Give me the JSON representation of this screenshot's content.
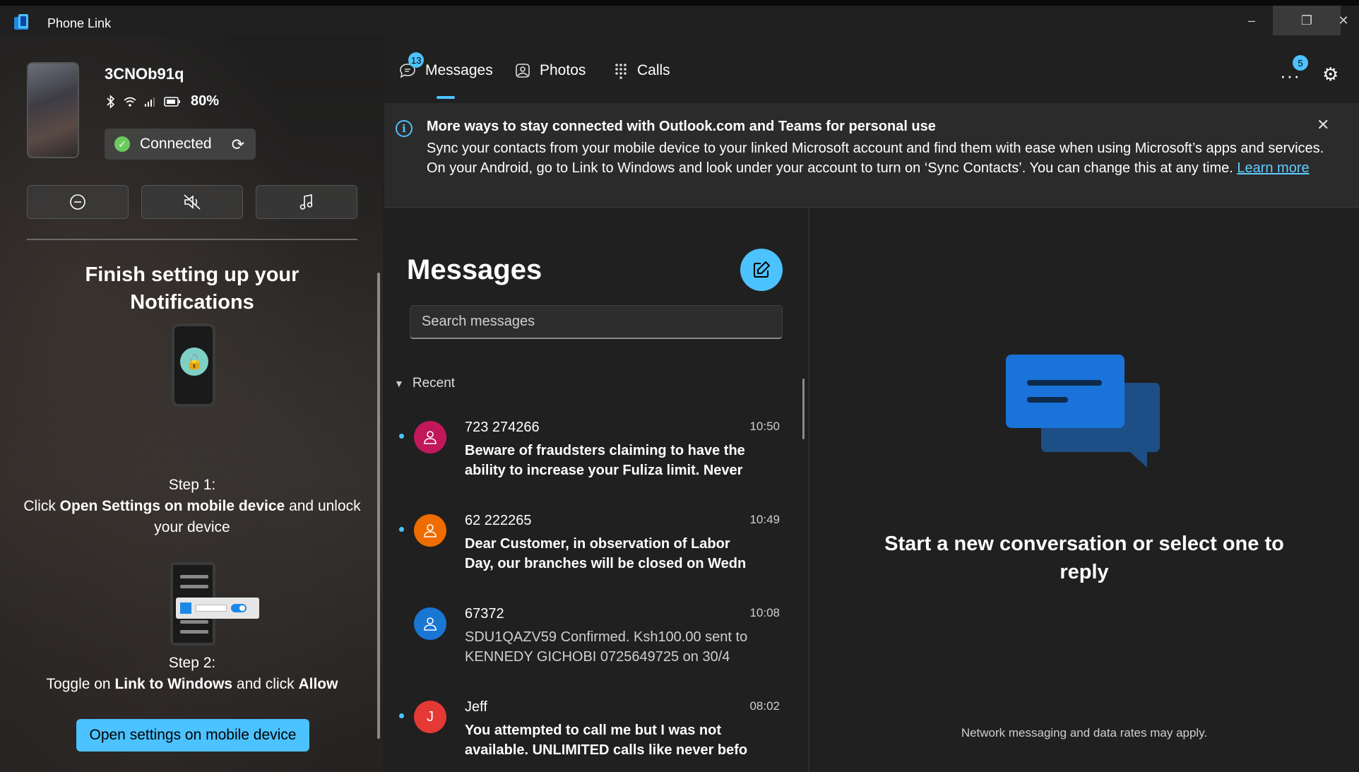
{
  "window": {
    "title": "Phone Link",
    "controls": {
      "minimize": "–",
      "restore": "❐",
      "close": "✕"
    }
  },
  "device": {
    "name": "3CNOb91q",
    "battery": "80%",
    "status": "Connected",
    "quick_actions": [
      "do-not-disturb",
      "mute-audio",
      "media-player"
    ]
  },
  "setup": {
    "title": "Finish setting up your Notifications",
    "step1_label": "Step 1:",
    "step1_text_a": "Click ",
    "step1_bold": "Open Settings on mobile device",
    "step1_text_b": " and unlock your device",
    "step2_label": "Step 2:",
    "step2_text_a": "Toggle on ",
    "step2_bold_a": "Link to Windows",
    "step2_text_b": " and click ",
    "step2_bold_b": "Allow",
    "button": "Open settings on mobile device"
  },
  "nav": {
    "tabs": [
      {
        "label": "Messages",
        "icon": "chat-icon",
        "badge": "13",
        "active": true
      },
      {
        "label": "Photos",
        "icon": "photos-icon"
      },
      {
        "label": "Calls",
        "icon": "dialpad-icon"
      }
    ],
    "more_badge": "5"
  },
  "banner": {
    "title": "More ways to stay connected with Outlook.com and Teams for personal use",
    "body": "Sync your contacts from your mobile device to your linked Microsoft account and find them with ease when using Microsoft’s apps and services. On your Android, go to Link to Windows and look under your account to turn on ‘Sync Contacts’. You can change this at any time. ",
    "link": "Learn more"
  },
  "messages": {
    "heading": "Messages",
    "search_placeholder": "Search messages",
    "section": "Recent",
    "items": [
      {
        "name": "723 274266",
        "time": "10:50",
        "preview": "Beware of fraudsters claiming to have the ability to increase your Fuliza limit. Never",
        "unread": true,
        "avatar_color": "#c2185b",
        "avatar_text": ""
      },
      {
        "name": "62 222265",
        "time": "10:49",
        "preview": "Dear Customer, in observation of Labor Day, our branches will be closed on Wedn",
        "unread": true,
        "avatar_color": "#ef6c00",
        "avatar_text": ""
      },
      {
        "name": "67372",
        "time": "10:08",
        "preview": "SDU1QAZV59 Confirmed. Ksh100.00 sent to KENNEDY  GICHOBI 0725649725 on 30/4",
        "unread": false,
        "avatar_color": "#1976d2",
        "avatar_text": ""
      },
      {
        "name": "Jeff",
        "time": "08:02",
        "preview": "You attempted to call me but I was not available. UNLIMITED calls like never befo",
        "unread": true,
        "avatar_color": "#e53935",
        "avatar_text": "J"
      }
    ]
  },
  "conversation": {
    "empty_title": "Start a new conversation or select one to reply",
    "note": "Network messaging and data rates may apply."
  },
  "colors": {
    "accent": "#4cc2ff",
    "link": "#60cdff",
    "connected": "#6ccb5f"
  }
}
